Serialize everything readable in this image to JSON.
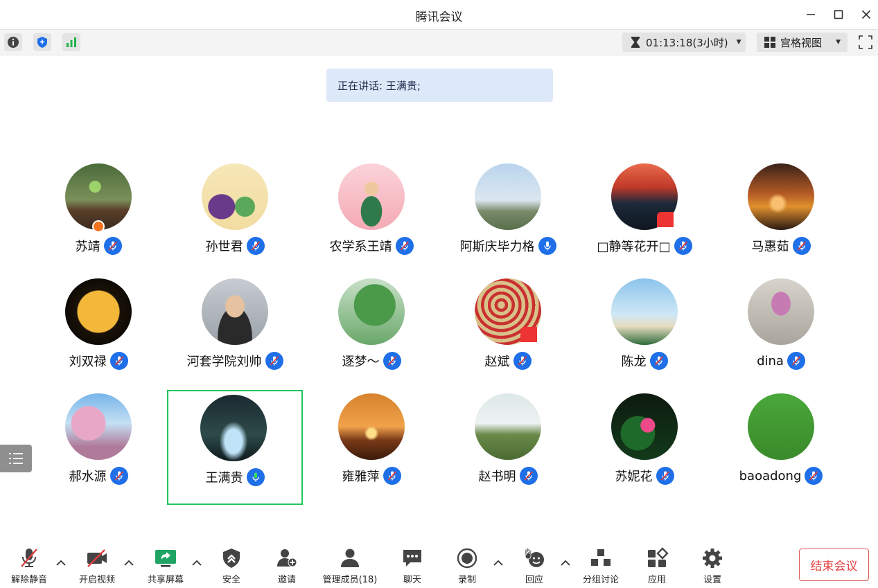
{
  "window": {
    "title": "腾讯会议"
  },
  "topbar": {
    "timer": "01:13:18(3小时)",
    "view_mode": "宫格视图"
  },
  "speaking": {
    "text": "正在讲话: 王满贵;"
  },
  "participants": [
    {
      "name": "苏靖",
      "mic": "muted",
      "badge": "host",
      "avatar": "seedling"
    },
    {
      "name": "孙世君",
      "mic": "muted",
      "avatar": "eggplant-cartoon"
    },
    {
      "name": "农学系王靖",
      "mic": "muted",
      "avatar": "child-pink"
    },
    {
      "name": "阿斯庆毕力格",
      "mic": "on",
      "avatar": "flag-sky"
    },
    {
      "name": "□静等花开□",
      "mic": "muted",
      "badge": "flag",
      "avatar": "stage-red"
    },
    {
      "name": "马惠茹",
      "mic": "muted",
      "avatar": "sunset-trees"
    },
    {
      "name": "刘双禄",
      "mic": "muted",
      "avatar": "moon"
    },
    {
      "name": "河套学院刘帅",
      "mic": "muted",
      "avatar": "man-glasses"
    },
    {
      "name": "逐梦～",
      "mic": "muted",
      "avatar": "green-tree"
    },
    {
      "name": "赵斌",
      "mic": "muted",
      "badge": "flag",
      "avatar": "red-coins"
    },
    {
      "name": "陈龙",
      "mic": "muted",
      "avatar": "palm-beach"
    },
    {
      "name": "dina",
      "mic": "muted",
      "avatar": "hyacinth"
    },
    {
      "name": "郝水源",
      "mic": "muted",
      "avatar": "pink-blossom"
    },
    {
      "name": "王满贵",
      "mic": "speaking",
      "active": true,
      "avatar": "waterfall-dark"
    },
    {
      "name": "雍雅萍",
      "mic": "muted",
      "avatar": "orange-sunset"
    },
    {
      "name": "赵书明",
      "mic": "muted",
      "avatar": "man-field"
    },
    {
      "name": "苏妮花",
      "mic": "muted",
      "avatar": "lotus"
    },
    {
      "name": "baoadong",
      "mic": "muted",
      "avatar": "green-grass"
    }
  ],
  "bottombar": {
    "unmute": "解除静音",
    "start_video": "开启视频",
    "share_screen": "共享屏幕",
    "security": "安全",
    "invite": "邀请",
    "manage_members": "管理成员(18)",
    "chat": "聊天",
    "record": "录制",
    "reactions": "回应",
    "breakout": "分组讨论",
    "apps": "应用",
    "settings": "设置",
    "end_meeting": "结束会议"
  },
  "colors": {
    "accent_blue": "#1e6fe8",
    "speaking_green": "#22c55e",
    "end_red": "#e13d3d",
    "share_green": "#1fa463"
  }
}
